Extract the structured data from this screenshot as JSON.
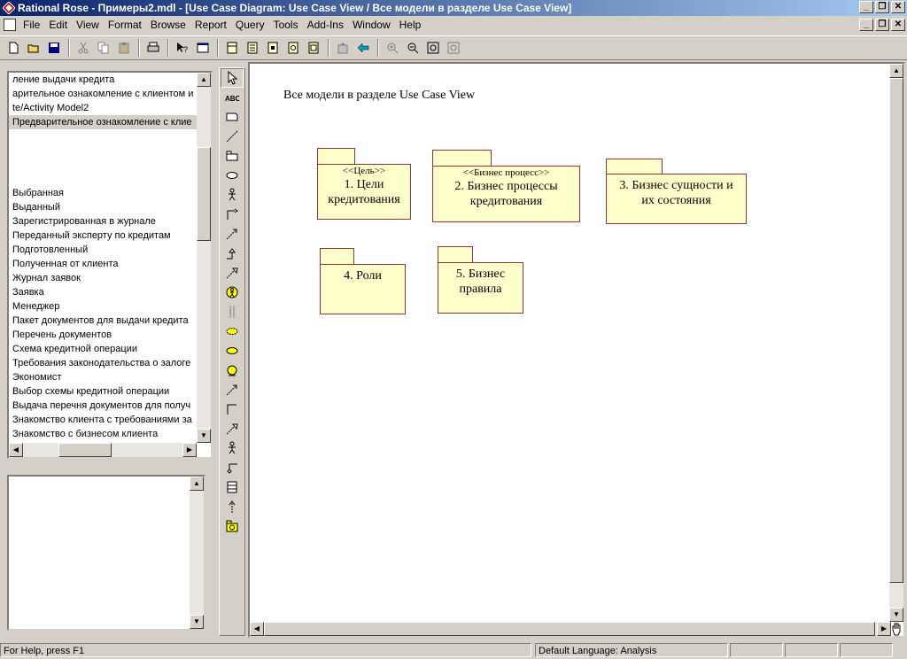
{
  "window": {
    "title": "Rational Rose - Примеры2.mdl - [Use Case Diagram: Use Case View / Все модели в разделе Use Case View]"
  },
  "menu": {
    "items": [
      "File",
      "Edit",
      "View",
      "Format",
      "Browse",
      "Report",
      "Query",
      "Tools",
      "Add-Ins",
      "Window",
      "Help"
    ]
  },
  "browser": {
    "items": [
      "ление выдачи кредита",
      "арительное ознакомление с клиентом и",
      "te/Activity Model2",
      "Предварительное ознакомление с клие",
      "",
      "",
      "",
      "",
      "Выбранная",
      "Выданный",
      "Зарегистрированная в журнале",
      "Переданный эксперту по кредитам",
      "Подготовленный",
      "Полученная от клиента",
      "Журнал заявок",
      "Заявка",
      "Менеджер",
      "Пакет документов для выдачи кредита",
      "Перечень документов",
      "Схема кредитной операции",
      "Требования законодательства о залоге",
      "Экономист",
      "Выбор схемы кредитной операции",
      "Выдача перечня документов для получ",
      "Знакомство клиента с требованиями за",
      "Знакомство с бизнесом клиента"
    ]
  },
  "diagram": {
    "title": "Все модели в разделе Use Case View",
    "packages": [
      {
        "stereotype": "<<Цель>>",
        "name_line1": "1. Цели",
        "name_line2": "кредитования"
      },
      {
        "stereotype": "<<Бизнес процесс>>",
        "name_line1": "2. Бизнес процессы",
        "name_line2": "кредитования"
      },
      {
        "stereotype": "",
        "name_line1": "3. Бизнес сущности и",
        "name_line2": "их состояния"
      },
      {
        "stereotype": "",
        "name_line1": "4. Роли",
        "name_line2": ""
      },
      {
        "stereotype": "",
        "name_line1": "5. Бизнес",
        "name_line2": "правила"
      }
    ]
  },
  "status": {
    "help": "For Help, press F1",
    "language": "Default Language: Analysis"
  },
  "colors": {
    "package_fill": "#ffffcc",
    "package_border": "#993333",
    "title_bar": "#0a246a"
  }
}
